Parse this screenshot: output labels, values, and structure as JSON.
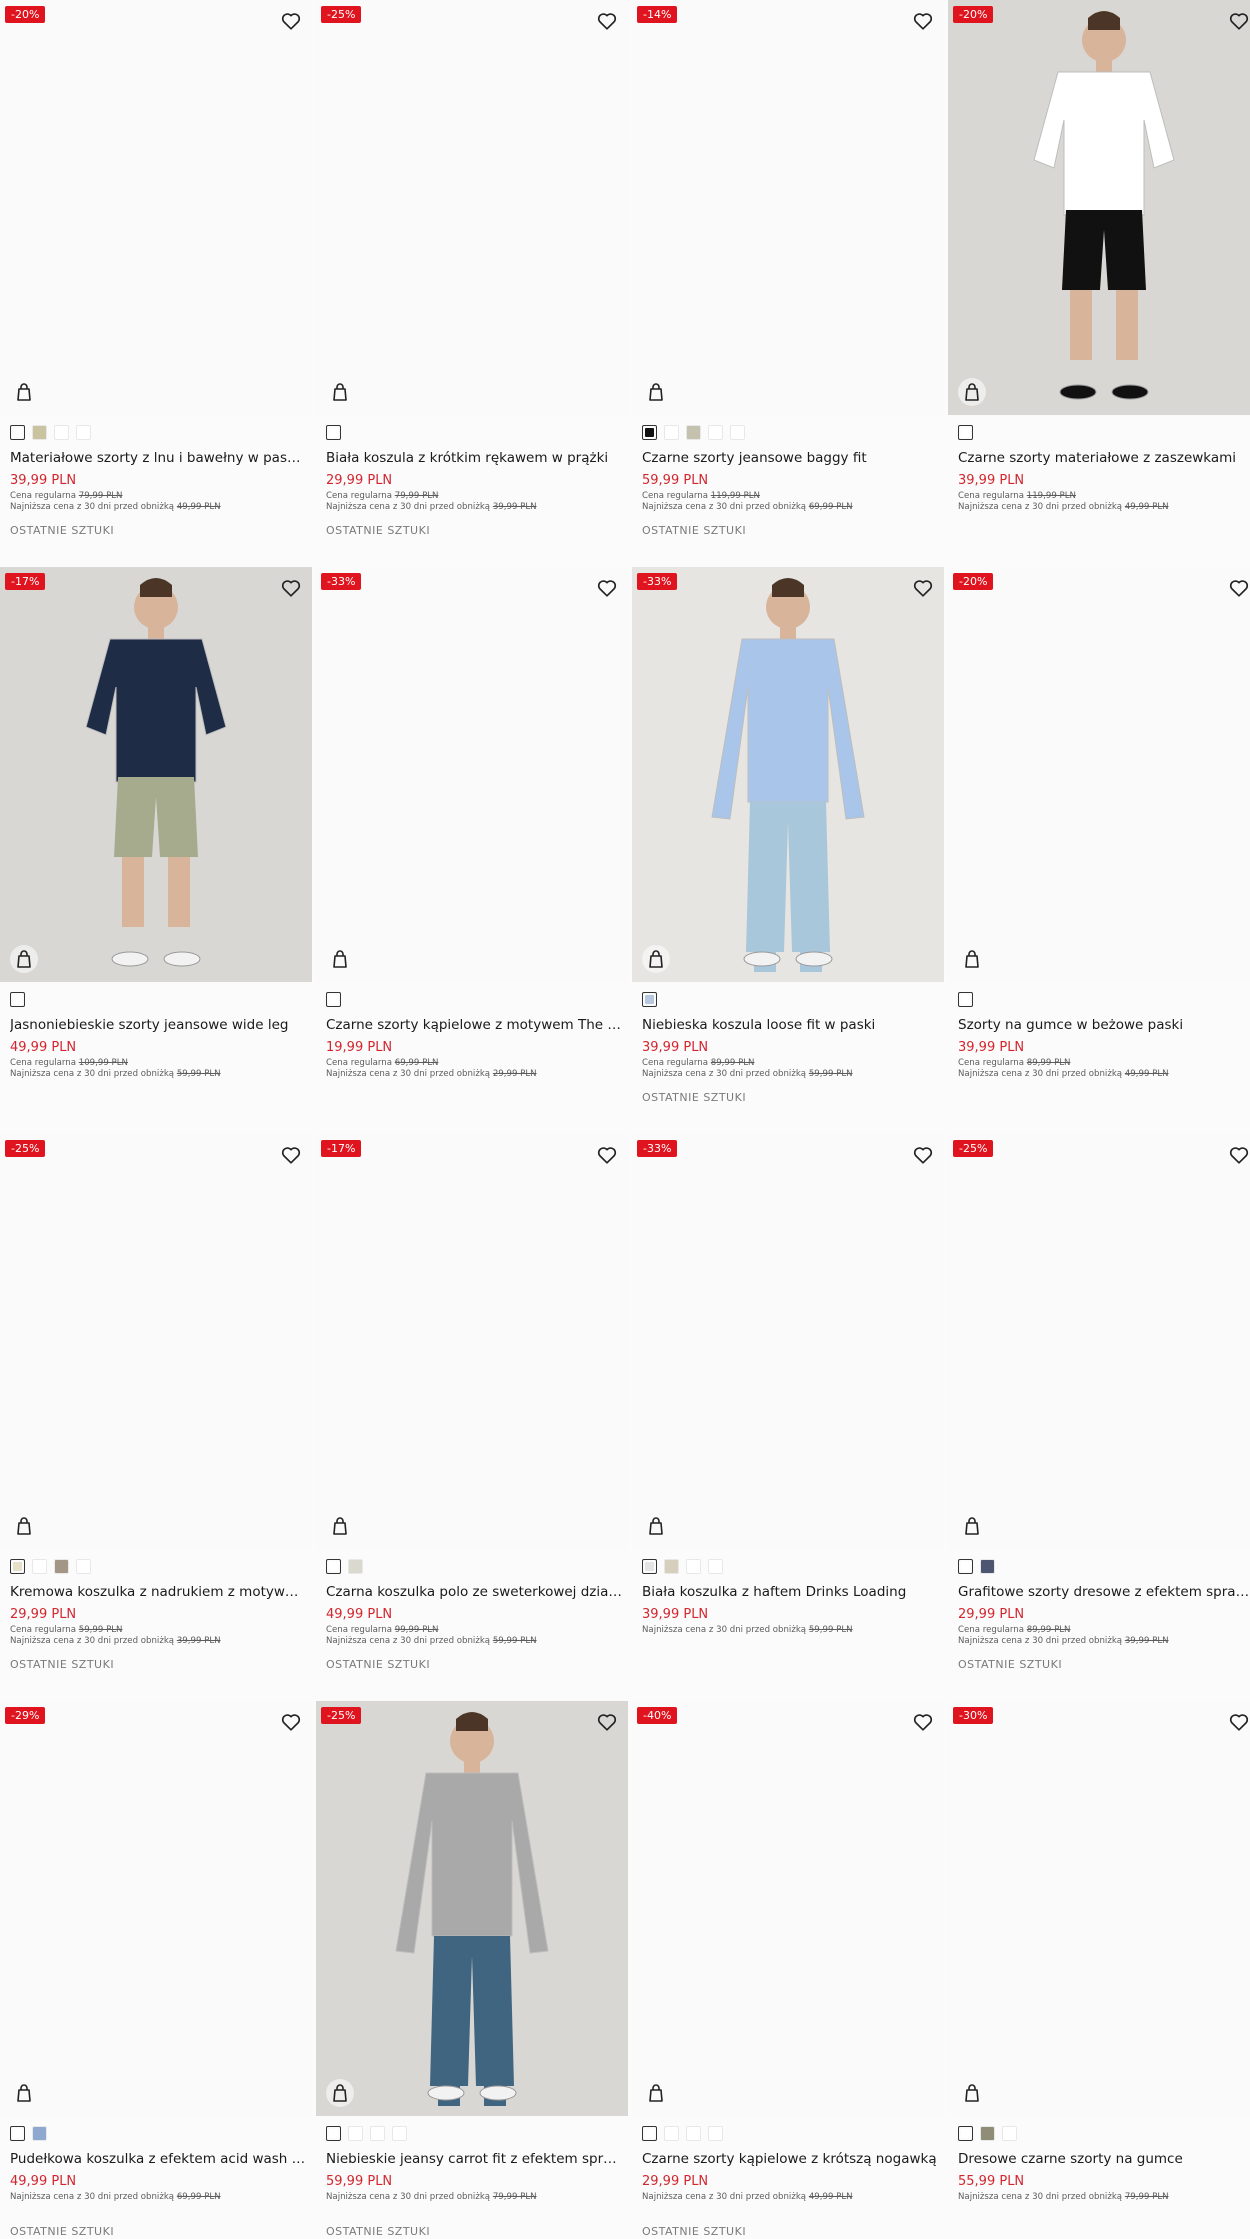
{
  "labels": {
    "regular": "Cena regularna",
    "lowest": "Najniższa cena z 30 dni przed obniżką",
    "last_items": "OSTATNIE SZTUKI"
  },
  "colors": {
    "badge": "#e0141e",
    "price": "#d2262f"
  },
  "products": [
    {
      "badge": "-20%",
      "title": "Materiałowe szorty z lnu i bawełny w paski b…",
      "price": "39,99 PLN",
      "regular": "79,99 PLN",
      "lowest": "49,99 PLN",
      "last": true,
      "image": false,
      "swatches": [
        "#ffffff",
        "#c9c3a0",
        "#ffffff",
        "#ffffff"
      ],
      "selected": 0
    },
    {
      "badge": "-25%",
      "title": "Biała koszula z krótkim rękawem w prążki",
      "price": "29,99 PLN",
      "regular": "79,99 PLN",
      "lowest": "39,99 PLN",
      "last": true,
      "image": false,
      "swatches": [
        "#ffffff"
      ],
      "selected": 0
    },
    {
      "badge": "-14%",
      "title": "Czarne szorty jeansowe baggy fit",
      "price": "59,99 PLN",
      "regular": "119,99 PLN",
      "lowest": "69,99 PLN",
      "last": true,
      "image": false,
      "swatches": [
        "#111111",
        "#ffffff",
        "#c4c1ae",
        "#ffffff",
        "#ffffff"
      ],
      "selected": 0
    },
    {
      "badge": "-20%",
      "title": "Czarne szorty materiałowe z zaszewkami",
      "price": "39,99 PLN",
      "regular": "119,99 PLN",
      "lowest": "49,99 PLN",
      "last": false,
      "image": true,
      "swatches": [
        "#ffffff"
      ],
      "selected": 0
    },
    {
      "badge": "-17%",
      "title": "Jasnoniebieskie szorty jeansowe wide leg",
      "price": "49,99 PLN",
      "regular": "109,99 PLN",
      "lowest": "59,99 PLN",
      "last": false,
      "image": true,
      "swatches": [
        "#ffffff"
      ],
      "selected": 0
    },
    {
      "badge": "-33%",
      "title": "Czarne szorty kąpielowe z motywem The Si…",
      "price": "19,99 PLN",
      "regular": "69,99 PLN",
      "lowest": "29,99 PLN",
      "last": false,
      "image": false,
      "swatches": [
        "#ffffff"
      ],
      "selected": 0
    },
    {
      "badge": "-33%",
      "title": "Niebieska koszula loose fit w paski",
      "price": "39,99 PLN",
      "regular": "89,99 PLN",
      "lowest": "59,99 PLN",
      "last": true,
      "image": true,
      "swatches": [
        "#b7c7e0"
      ],
      "selected": 0
    },
    {
      "badge": "-20%",
      "title": "Szorty na gumce w beżowe paski",
      "price": "39,99 PLN",
      "regular": "89,99 PLN",
      "lowest": "49,99 PLN",
      "last": false,
      "image": false,
      "swatches": [
        "#ffffff"
      ],
      "selected": 0
    },
    {
      "badge": "-25%",
      "title": "Kremowa koszulka z nadrukiem z motywem …",
      "price": "29,99 PLN",
      "regular": "59,99 PLN",
      "lowest": "39,99 PLN",
      "last": true,
      "image": false,
      "swatches": [
        "#e6e0c8",
        "#ffffff",
        "#a49684",
        "#ffffff"
      ],
      "selected": 0
    },
    {
      "badge": "-17%",
      "title": "Czarna koszulka polo ze sweterkowej dzianiny",
      "price": "49,99 PLN",
      "regular": "99,99 PLN",
      "lowest": "59,99 PLN",
      "last": true,
      "image": false,
      "swatches": [
        "#ffffff",
        "#dad9cf"
      ],
      "selected": 0
    },
    {
      "badge": "-33%",
      "title": "Biała koszulka z haftem Drinks Loading",
      "price": "39,99 PLN",
      "regular": "",
      "lowest": "59,99 PLN",
      "last": false,
      "image": false,
      "swatches": [
        "#e4e4e4",
        "#d6cfbe",
        "#ffffff",
        "#ffffff"
      ],
      "selected": 0
    },
    {
      "badge": "-25%",
      "title": "Grafitowe szorty dresowe z efektem sprania",
      "price": "29,99 PLN",
      "regular": "89,99 PLN",
      "lowest": "39,99 PLN",
      "last": true,
      "image": false,
      "swatches": [
        "#ffffff",
        "#4c5670"
      ],
      "selected": 0
    },
    {
      "badge": "-29%",
      "title": "Pudełkowa koszulka z efektem acid wash cz…",
      "price": "49,99 PLN",
      "regular": "",
      "lowest": "69,99 PLN",
      "last": true,
      "image": false,
      "swatches": [
        "#ffffff",
        "#8ea8d0"
      ],
      "selected": 0
    },
    {
      "badge": "-25%",
      "title": "Niebieskie jeansy carrot fit z efektem sprania",
      "price": "59,99 PLN",
      "regular": "",
      "lowest": "79,99 PLN",
      "last": true,
      "image": true,
      "swatches": [
        "#ffffff",
        "#ffffff",
        "#ffffff",
        "#ffffff"
      ],
      "selected": 0
    },
    {
      "badge": "-40%",
      "title": "Czarne szorty kąpielowe z krótszą nogawką",
      "price": "29,99 PLN",
      "regular": "",
      "lowest": "49,99 PLN",
      "last": true,
      "image": false,
      "swatches": [
        "#ffffff",
        "#ffffff",
        "#ffffff",
        "#ffffff"
      ],
      "selected": 0
    },
    {
      "badge": "-30%",
      "title": "Dresowe czarne szorty na gumce",
      "price": "55,99 PLN",
      "regular": "",
      "lowest": "79,99 PLN",
      "last": false,
      "image": false,
      "swatches": [
        "#ffffff",
        "#8f8c78",
        "#ffffff"
      ],
      "selected": 0
    }
  ]
}
